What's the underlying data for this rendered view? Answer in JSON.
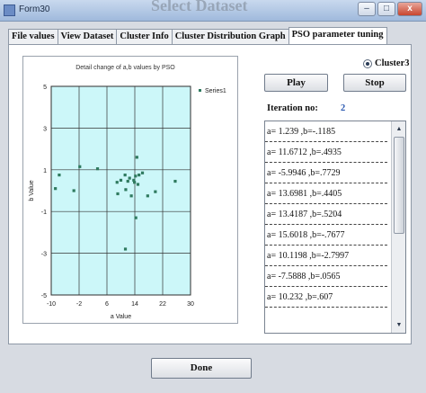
{
  "window": {
    "title": "Form30",
    "background_title": "Select Dataset",
    "controls": {
      "minimize": "–",
      "maximize": "□",
      "close": "x"
    }
  },
  "tabs": [
    {
      "label": "File values",
      "active": false
    },
    {
      "label": "View Dataset",
      "active": false
    },
    {
      "label": "Cluster Info",
      "active": false
    },
    {
      "label": "Cluster Distribution Graph",
      "active": false
    },
    {
      "label": "PSO parameter tuning",
      "active": true
    }
  ],
  "chart_data": {
    "type": "scatter",
    "title": "Detail change of a,b values by  PSO",
    "xlabel": "a Value",
    "ylabel": "b Value",
    "xlim": [
      -10,
      30
    ],
    "ylim": [
      -5,
      5
    ],
    "xticks": [
      "-10",
      "-2",
      "6",
      "14",
      "22",
      "30"
    ],
    "yticks": [
      "5",
      "3",
      "1",
      "-1",
      "-3",
      "-5"
    ],
    "grid": true,
    "plot_background": "#ccf7f9",
    "marker_color": "#2f7a5f",
    "legend": "top-right",
    "series": [
      {
        "name": "Series1",
        "points": [
          [
            -8.8,
            0.1
          ],
          [
            -7.7,
            0.75
          ],
          [
            -3.5,
            0.0
          ],
          [
            -1.8,
            1.15
          ],
          [
            3.3,
            1.05
          ],
          [
            8.9,
            0.4
          ],
          [
            9.1,
            -0.15
          ],
          [
            10.0,
            0.5
          ],
          [
            11.2,
            0.75
          ],
          [
            11.4,
            0.05
          ],
          [
            12.0,
            0.45
          ],
          [
            12.5,
            0.6
          ],
          [
            13.0,
            -0.25
          ],
          [
            13.7,
            0.5
          ],
          [
            13.9,
            0.4
          ],
          [
            14.2,
            0.7
          ],
          [
            14.6,
            1.6
          ],
          [
            14.9,
            0.3
          ],
          [
            15.2,
            0.75
          ],
          [
            16.2,
            0.85
          ],
          [
            17.7,
            -0.25
          ],
          [
            19.9,
            -0.05
          ],
          [
            14.3,
            -1.3
          ],
          [
            11.3,
            -2.8
          ],
          [
            25.6,
            0.45
          ]
        ]
      }
    ]
  },
  "cluster_radio": {
    "label": "Cluster3"
  },
  "buttons": {
    "play": "Play",
    "stop": "Stop",
    "done": "Done"
  },
  "iteration": {
    "label": "Iteration no:",
    "value": "2"
  },
  "results_list": [
    "a= 1.239 ,b=-.1185",
    "a= 11.6712 ,b=.4935",
    "a= -5.9946 ,b=.7729",
    "a= 13.6981 ,b=.4405",
    "a= 13.4187 ,b=.5204",
    "a= 15.6018 ,b=-.7677",
    "a= 10.1198 ,b=-2.7997",
    "a= -7.5888 ,b=.0565",
    "a= 10.232 ,b=.607"
  ]
}
